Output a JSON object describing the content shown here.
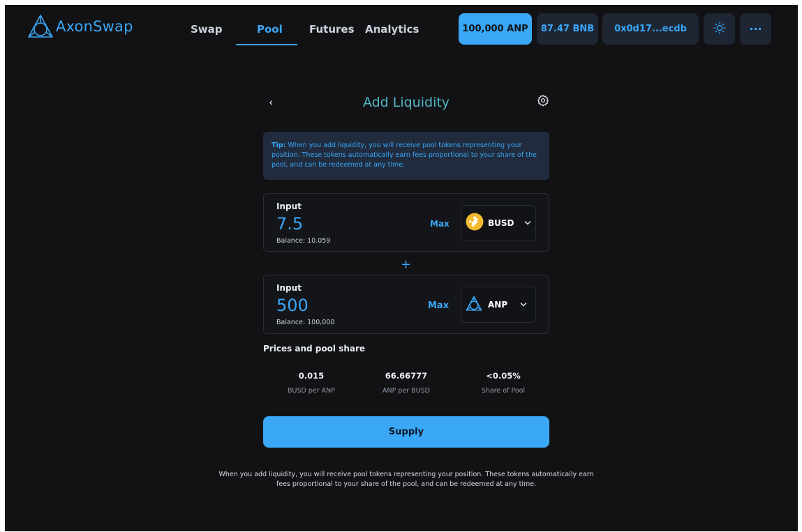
{
  "brand": {
    "name": "AxonSwap",
    "icon": "axon-logo-icon",
    "accent": "#3aa7f7"
  },
  "nav": {
    "items": [
      {
        "label": "Swap",
        "active": false
      },
      {
        "label": "Pool",
        "active": true
      },
      {
        "label": "Futures",
        "active": false
      },
      {
        "label": "Analytics",
        "active": false
      }
    ]
  },
  "header": {
    "anp_balance": "100,000 ANP",
    "bnb_balance": "87.47 BNB",
    "wallet": "0x0d17...ecdb",
    "theme_icon": "sun-icon",
    "more_icon": "more-dots-icon",
    "more_label": "···"
  },
  "page": {
    "title": "Add Liquidity",
    "back_icon": "chevron-left-icon",
    "back_glyph": "‹",
    "settings_icon": "gear-icon"
  },
  "tip": {
    "label": "Tip:",
    "text": " When you add liquidity, you will receive pool tokens representing your position. These tokens automatically earn fees proportional to your share of the pool, and can be redeemed at any time."
  },
  "inputs": [
    {
      "label": "Input",
      "value": "7.5",
      "balance": "Balance:  10.059",
      "max_label": "Max",
      "token": "BUSD",
      "token_icon": "busd-icon",
      "token_color": "#f3ba2f"
    },
    {
      "label": "Input",
      "value": "500",
      "balance": "Balance:  100,000",
      "max_label": "Max",
      "token": "ANP",
      "token_icon": "anp-icon"
    }
  ],
  "plus_glyph": "+",
  "prices": {
    "title": "Prices and pool share",
    "stats": [
      {
        "value": "0.015",
        "label": "BUSD per ANP"
      },
      {
        "value": "66.66777",
        "label": "ANP per BUSD"
      },
      {
        "value": "<0.05%",
        "label": "Share of Pool"
      }
    ]
  },
  "supply_label": "Supply",
  "footnote": "When you add liquidity, you will receive pool tokens representing your position. These tokens automatically earn fees proportional to your share of the pool, and can be redeemed at any time."
}
